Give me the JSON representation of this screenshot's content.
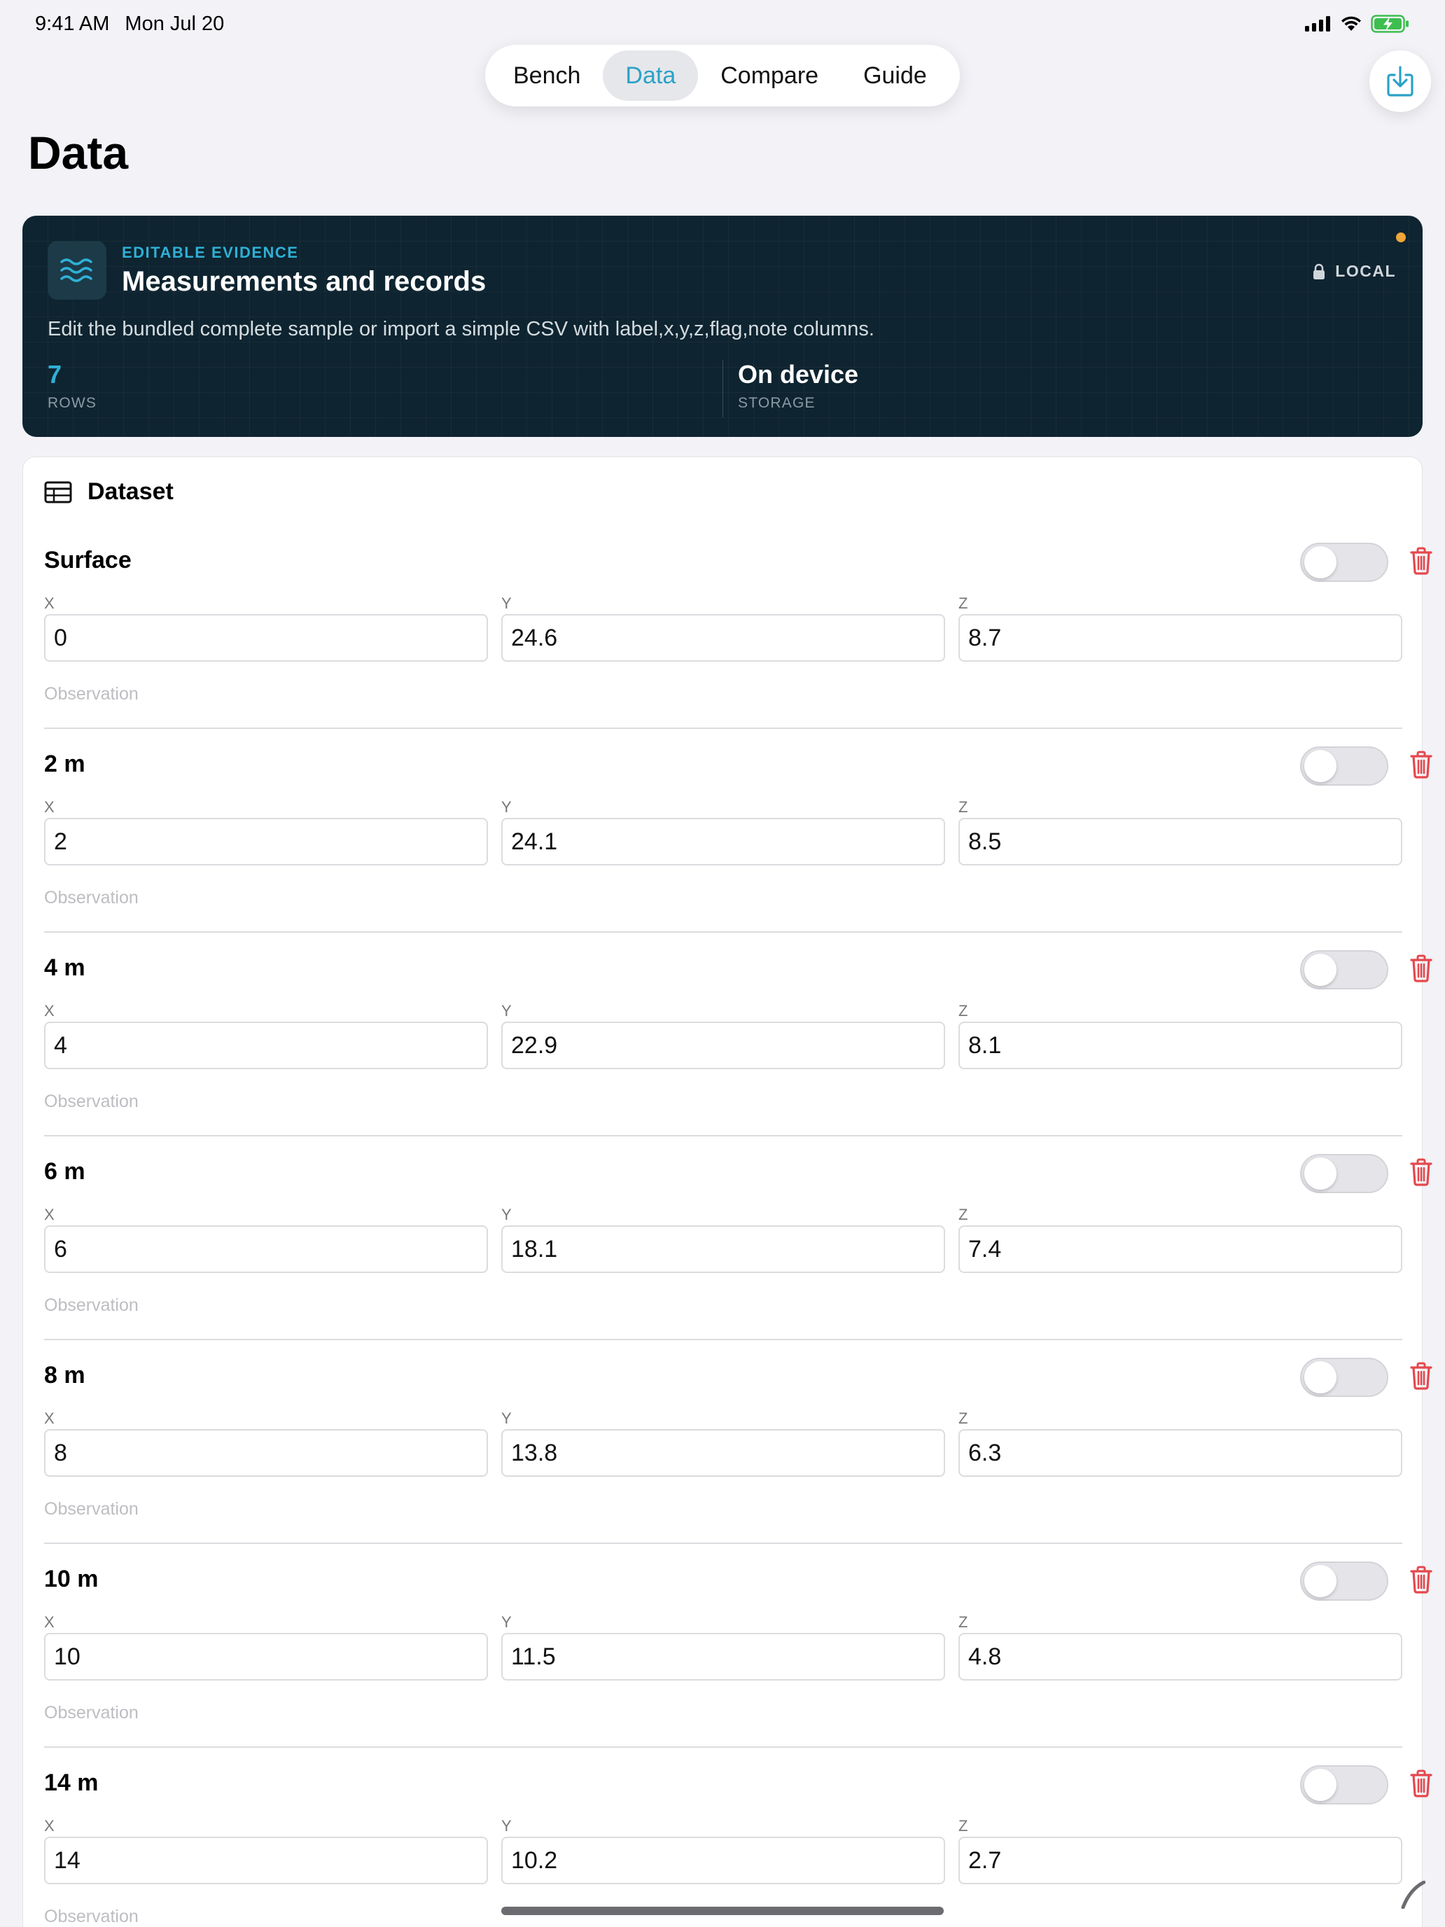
{
  "status": {
    "time": "9:41 AM",
    "date": "Mon Jul 20"
  },
  "nav": {
    "tabs": [
      "Bench",
      "Data",
      "Compare",
      "Guide"
    ],
    "active": "Data"
  },
  "page": {
    "title": "Data"
  },
  "hero": {
    "kicker": "EDITABLE EVIDENCE",
    "title": "Measurements and records",
    "badge": "LOCAL",
    "description": "Edit the bundled complete sample or import a simple CSV with label,x,y,z,flag,note columns.",
    "stats": [
      {
        "value": "7",
        "label": "ROWS"
      },
      {
        "value": "On device",
        "label": "STORAGE"
      }
    ]
  },
  "dataset": {
    "title": "Dataset",
    "axis_labels": {
      "x": "X",
      "y": "Y",
      "z": "Z"
    },
    "observation_placeholder": "Observation",
    "rows": [
      {
        "label": "Surface",
        "x": "0",
        "y": "24.6",
        "z": "8.7"
      },
      {
        "label": "2 m",
        "x": "2",
        "y": "24.1",
        "z": "8.5"
      },
      {
        "label": "4 m",
        "x": "4",
        "y": "22.9",
        "z": "8.1"
      },
      {
        "label": "6 m",
        "x": "6",
        "y": "18.1",
        "z": "7.4"
      },
      {
        "label": "8 m",
        "x": "8",
        "y": "13.8",
        "z": "6.3"
      },
      {
        "label": "10 m",
        "x": "10",
        "y": "11.5",
        "z": "4.8"
      },
      {
        "label": "14 m",
        "x": "14",
        "y": "10.2",
        "z": "2.7"
      }
    ]
  },
  "colors": {
    "accent": "#2aa2c8",
    "hero_bg": "#0e2430",
    "danger": "#e5484d",
    "status_dot": "#f0a63a"
  }
}
